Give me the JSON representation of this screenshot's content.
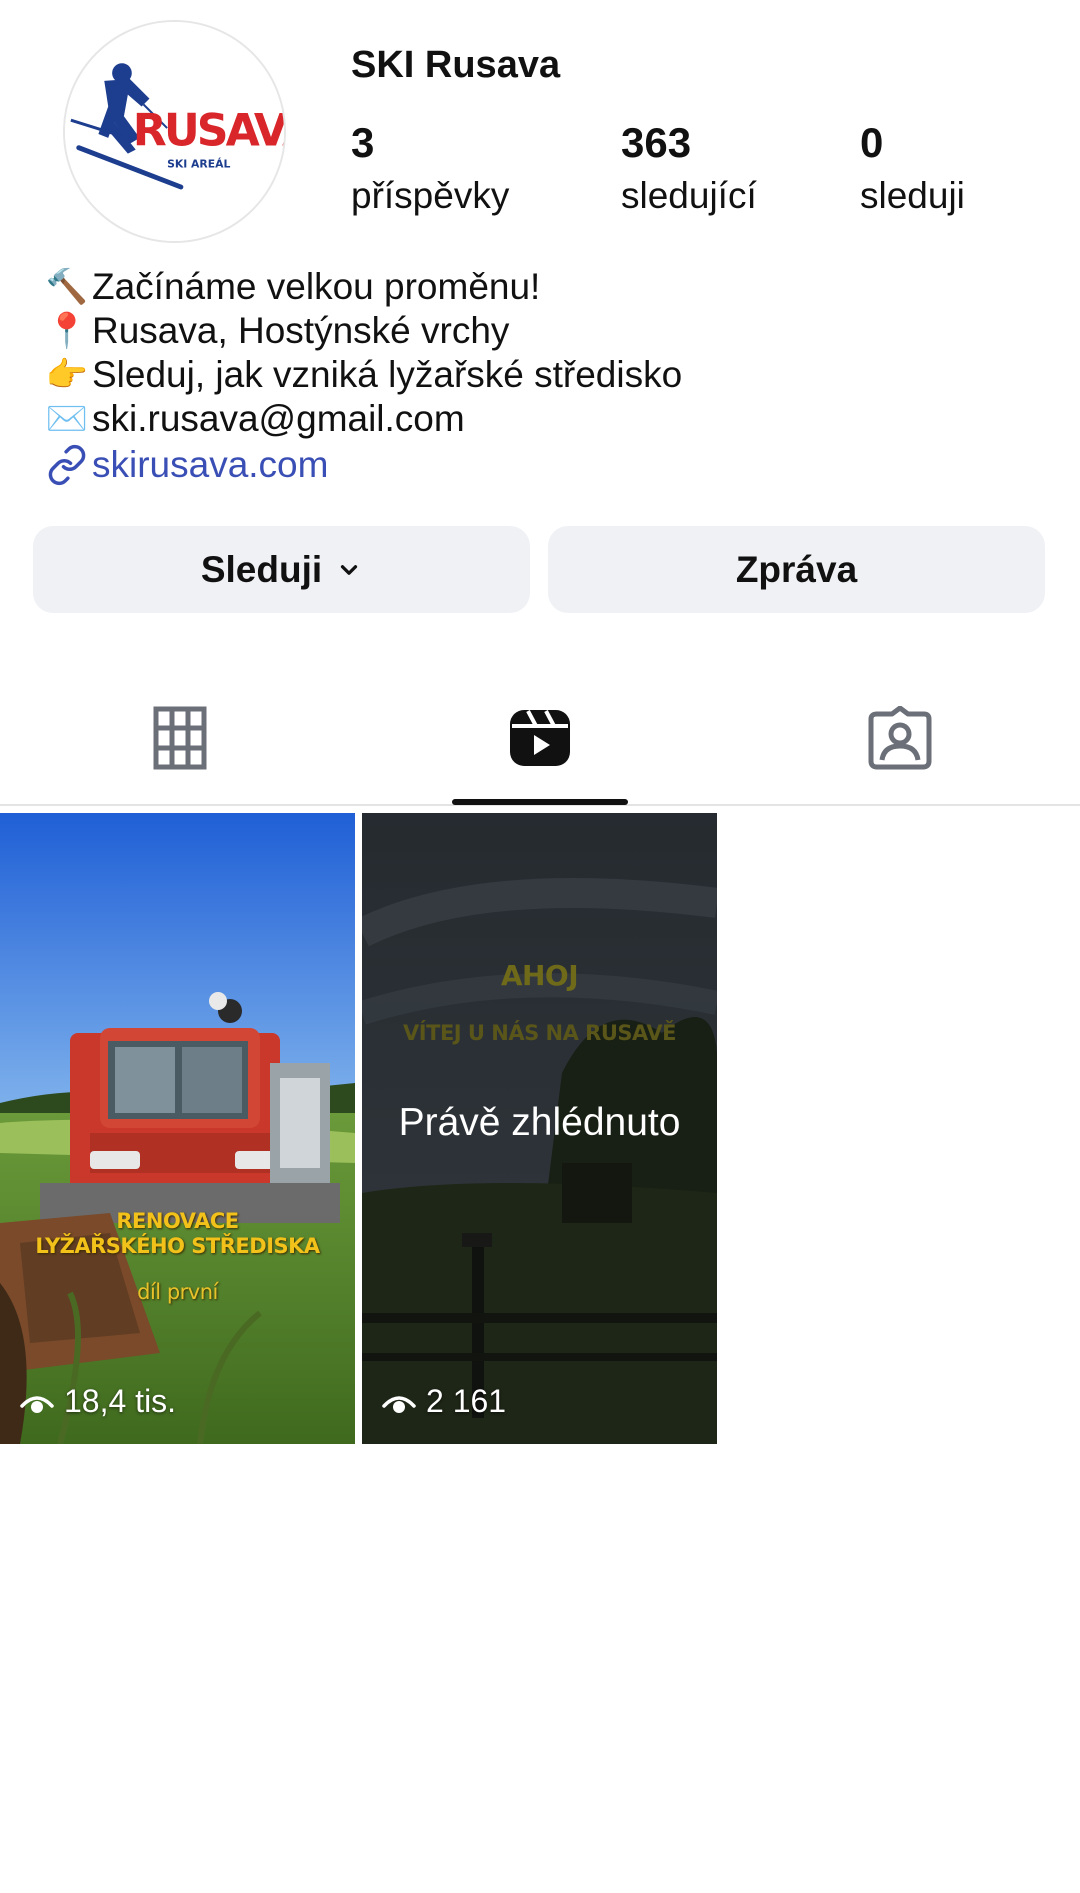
{
  "profile": {
    "name": "SKI Rusava",
    "avatar": {
      "logo_text": "RUSAVA",
      "logo_subtext": "SKI AREÁL",
      "brand_red": "#d8262b",
      "brand_blue": "#1d3d8f"
    },
    "stats": [
      {
        "value": "3",
        "label": "příspěvky"
      },
      {
        "value": "363",
        "label": "sledující"
      },
      {
        "value": "0",
        "label": "sleduji"
      }
    ]
  },
  "bio": {
    "lines": [
      {
        "emoji": "🔨",
        "text": "Začínáme velkou proměnu!"
      },
      {
        "emoji": "📍",
        "text": "Rusava, Hostýnské vrchy"
      },
      {
        "emoji": "👉",
        "text": "Sleduj, jak vzniká lyžařské středisko"
      },
      {
        "emoji": "✉️",
        "text": "ski.rusava@gmail.com"
      }
    ],
    "link": {
      "icon": "link-icon",
      "text": "skirusava.com",
      "color": "#3a4fb5"
    }
  },
  "actions": {
    "follow_label": "Sleduji",
    "message_label": "Zpráva"
  },
  "tabs": [
    {
      "name": "grid",
      "icon": "grid-icon",
      "active": false
    },
    {
      "name": "reels",
      "icon": "reels-icon",
      "active": true
    },
    {
      "name": "tagged",
      "icon": "tagged-icon",
      "active": false
    }
  ],
  "reels": [
    {
      "caption_lines": [
        "RENOVACE",
        "LYŽAŘSKÉHO STŘEDISKA",
        "díl první"
      ],
      "views": "18,4 tis.",
      "watched_label": ""
    },
    {
      "caption_lines": [
        "AHOJ",
        "VÍTEJ U NÁS NA RUSAVĚ"
      ],
      "views": "2 161",
      "watched_label": "Právě zhlédnuto"
    }
  ]
}
